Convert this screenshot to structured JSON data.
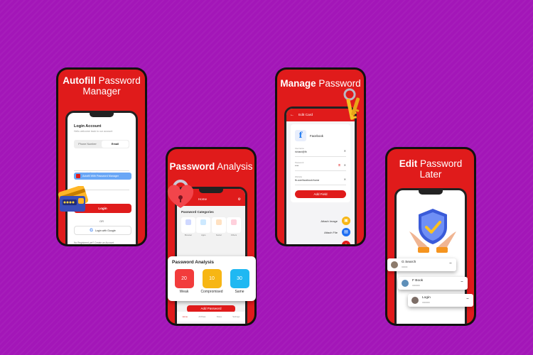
{
  "phones": {
    "autofill": {
      "title_bold": "Autofill",
      "title_rest": "Password",
      "title_line2": "Manager",
      "login_title": "Login Account",
      "login_subtitle": "Hello welcome back to our account",
      "tab_phone": "Phone Number",
      "tab_email": "Email",
      "email_placeholder": "example@gmail.com",
      "autofill_banner": "Autofill With Password Manager",
      "login_button": "Login",
      "or_text": "OR",
      "google_button": "Login with Google",
      "footer_text": "No Registered yet? Create an Account"
    },
    "analysis": {
      "title_bold": "Password",
      "title_rest": "Analysis",
      "nav_home": "Home",
      "categories_title": "Password Categories",
      "cat_labels": [
        "Browser",
        "Apps",
        "Social",
        "Others"
      ],
      "section_label": "Password Analysis",
      "add_button": "Add Password",
      "nav_items": [
        "Home",
        "All Pass",
        "Notes",
        "Settings"
      ]
    },
    "manage": {
      "title_bold": "Manage",
      "title_rest": "Password",
      "header": "Edit Card",
      "site_name": "Facebook",
      "username_label": "Username",
      "username_value": "richard@fb",
      "password_label": "Password",
      "password_value": "****",
      "website_label": "Website",
      "website_value": "fb.com/facebook/home",
      "add_field_button": "Add Field",
      "attach_image": "Attach Image",
      "attach_file": "Attach File"
    },
    "edit": {
      "title_bold": "Edit",
      "title_rest": "Password",
      "title_line2": "Later",
      "entries": [
        {
          "name": "G Search",
          "dots": "••••••••••"
        },
        {
          "name": "F Book",
          "dots": "•••••••••••••"
        },
        {
          "name": "Login",
          "dots": "•••••••••••••"
        }
      ]
    }
  },
  "analysis_popup": {
    "title": "Password Analysis",
    "stats": [
      {
        "value": "20",
        "label": "Weak",
        "color": "#f23c3c"
      },
      {
        "value": "10",
        "label": "Compromised",
        "color": "#f7b614"
      },
      {
        "value": "30",
        "label": "Same",
        "color": "#1fb8f2"
      }
    ]
  },
  "colors": {
    "background": "#a316b8",
    "brand_red": "#e01b1b"
  }
}
